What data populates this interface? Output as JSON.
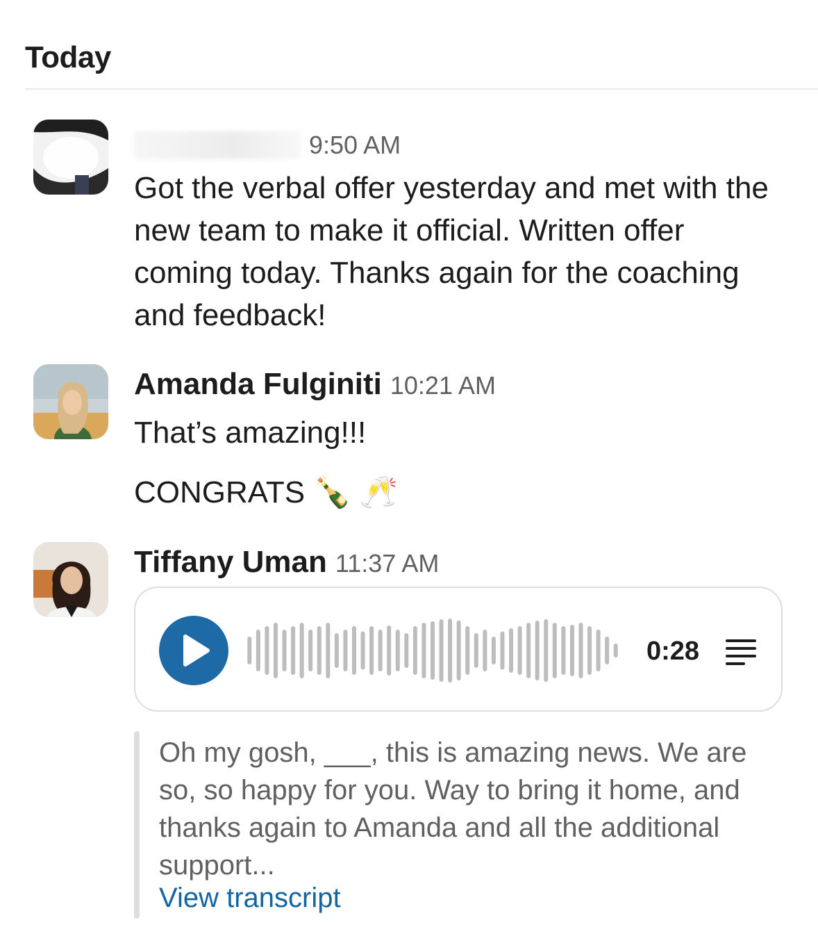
{
  "day_header": "Today",
  "messages": [
    {
      "sender": "",
      "time": "9:50 AM",
      "text": "Got the verbal offer yesterday and met with the new team to make it official. Written offer coming today. Thanks again for the coaching and feedback!"
    },
    {
      "sender": "Amanda Fulginiti",
      "time": "10:21 AM",
      "text": "That’s amazing!!!",
      "text2": "CONGRATS 🍾 🥂"
    },
    {
      "sender": "Tiffany Uman",
      "time": "11:37 AM",
      "audio": {
        "duration": "0:28",
        "play_icon": "play-icon",
        "transcript_icon": "transcript-icon",
        "accent_color": "#1d6aa6"
      },
      "transcript": {
        "text": "Oh my gosh, ___, this is amazing news. We are so, so happy for you. Way to bring it home, and thanks again to Amanda and all the additional support...",
        "link_label": "View transcript",
        "link_color": "#1264a3"
      }
    }
  ]
}
